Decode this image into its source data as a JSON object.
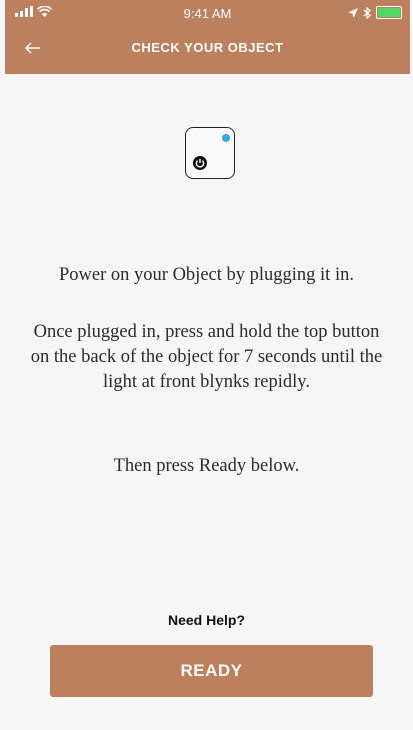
{
  "status": {
    "time": "9:41 AM",
    "signal_icon": "signal-bars-icon",
    "wifi_icon": "wifi-icon",
    "location_icon": "location-arrow-icon",
    "bluetooth_icon": "bluetooth-icon",
    "battery_icon": "battery-icon",
    "battery_level": 1.0
  },
  "header": {
    "back_icon": "back-arrow-icon",
    "title": "CHECK YOUR OBJECT"
  },
  "illustration": {
    "device_icon": "device-icon",
    "power_icon": "power-icon",
    "led_color": "#3aa7e6"
  },
  "instructions": {
    "line1": "Power on your Object by plugging it in.",
    "line2": "Once plugged in, press and hold the top button on the back of the object for 7 seconds until the light at front blynks repidly.",
    "line3": "Then press Ready below."
  },
  "footer": {
    "help_label": "Need Help?",
    "ready_label": "READY"
  },
  "colors": {
    "accent": "#bc805e",
    "background": "#f6f6f6",
    "battery": "#4cd964"
  }
}
